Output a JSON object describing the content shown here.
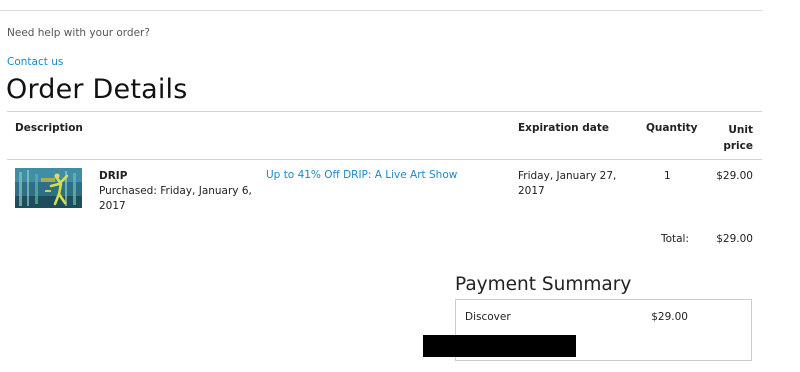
{
  "help": {
    "question": "Need help with your order?",
    "contact_label": "Contact us"
  },
  "page_title": "Order Details",
  "table": {
    "headers": {
      "description": "Description",
      "expiration": "Expiration date",
      "quantity": "Quantity",
      "unit_price_line1": "Unit",
      "unit_price_line2": "price"
    },
    "rows": [
      {
        "name": "DRIP",
        "purchased_line1": "Purchased: Friday, January 6,",
        "purchased_line2": "2017",
        "deal_label": "Up to 41% Off DRIP: A Live Art Show",
        "expiration_line1": "Friday, January 27,",
        "expiration_line2": "2017",
        "quantity": "1",
        "unit_price": "$29.00"
      }
    ],
    "total_label": "Total:",
    "total_value": "$29.00"
  },
  "payment": {
    "title": "Payment Summary",
    "method": "Discover",
    "amount": "$29.00"
  },
  "colors": {
    "link": "#1a8ac6",
    "rule": "#d2d2d2",
    "redaction": "#000000"
  }
}
